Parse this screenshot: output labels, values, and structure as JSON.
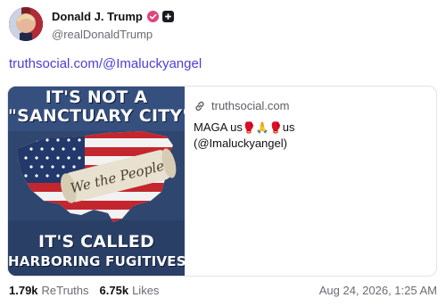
{
  "author": {
    "display_name": "Donald J. Trump",
    "handle": "@realDonaldTrump",
    "verified_icon": "verified-badge-icon",
    "badge_icon": "plus-badge-icon"
  },
  "post": {
    "link_text": "truthsocial.com/@Imaluckyangel"
  },
  "card": {
    "domain": "truthsocial.com",
    "title_parts": [
      "MAGA us",
      "🥊",
      "🙏",
      "🥊",
      "us",
      "(@Imaluckyangel)"
    ],
    "image_text": {
      "line1": "IT'S NOT A",
      "line2": "\"SANCTUARY CITY\"",
      "line3": "IT'S CALLED",
      "line4": "HARBORING FUGITIVES",
      "scroll_text": "We the People"
    }
  },
  "stats": {
    "retruths_count": "1.79k",
    "retruths_label": "ReTruths",
    "likes_count": "6.75k",
    "likes_label": "Likes",
    "timestamp": "Aug 24, 2026, 1:25 AM"
  },
  "colors": {
    "link": "#4b3fd6",
    "verified": "#e0457b",
    "muted": "#6b6b75"
  }
}
